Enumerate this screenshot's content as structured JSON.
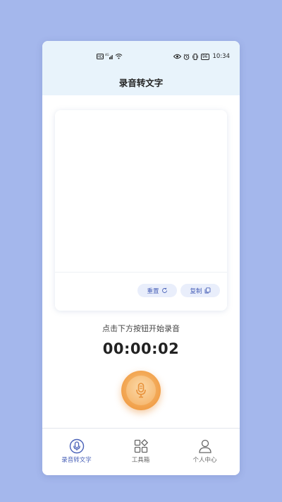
{
  "status_bar": {
    "time": "10:34",
    "battery": "96",
    "left_icons": [
      "hd-icon",
      "signal-4g-icon",
      "wifi-icon"
    ],
    "right_icons": [
      "eye-icon",
      "alarm-icon",
      "vibrate-icon",
      "battery-icon"
    ]
  },
  "header": {
    "title": "录音转文字"
  },
  "card": {
    "reset_label": "重置",
    "copy_label": "复制"
  },
  "recorder": {
    "hint": "点击下方按钮开始录音",
    "timer": "00:00:02"
  },
  "tabs": [
    {
      "label": "录音转文字",
      "icon": "mic-tab-icon",
      "active": true
    },
    {
      "label": "工具箱",
      "icon": "toolbox-icon",
      "active": false
    },
    {
      "label": "个人中心",
      "icon": "person-icon",
      "active": false
    }
  ],
  "colors": {
    "page_bg": "#a4b7ec",
    "header_bg": "#e8f3fb",
    "accent_blue": "#4a62b8",
    "mic_orange": "#f1a04a"
  }
}
